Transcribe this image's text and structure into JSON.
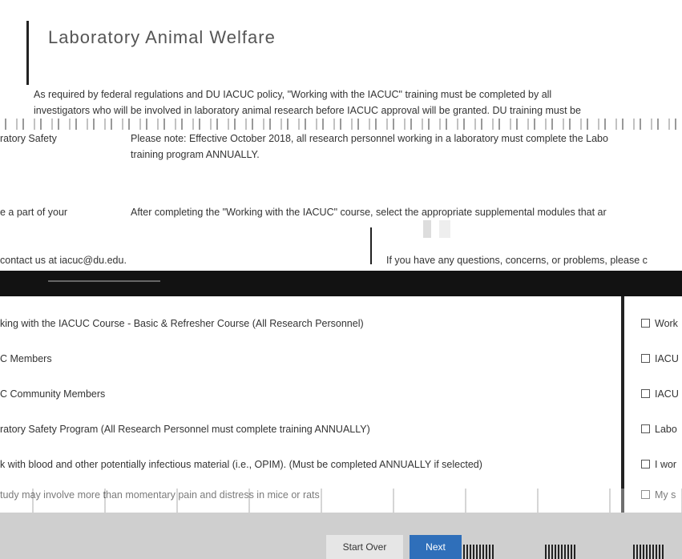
{
  "header": {
    "title": "Laboratory Animal Welfare"
  },
  "intro": {
    "line1": "As required by federal regulations and DU IACUC policy, \"Working with the IACUC\" training must be completed by all",
    "line2": "investigators who will be involved in laboratory animal research before IACUC approval will be granted. DU training must be"
  },
  "left_snippets": {
    "lab_safety": "ratory Safety",
    "part_of_your": "e a part of your",
    "contact": "contact us at iacuc@du.edu."
  },
  "notes": {
    "note1": "Please note: Effective October 2018, all research personnel working in a laboratory must complete the Labo",
    "note1b": "training program ANNUALLY.",
    "note2": "After completing the \"Working with the IACUC\" course, select the appropriate supplemental modules that ar",
    "note3": "If you have any questions, concerns, or problems, please c"
  },
  "modules": [
    {
      "label": "king with the IACUC Course - Basic & Refresher Course (All Research Personnel)",
      "check_label": "Work"
    },
    {
      "label": "C Members",
      "check_label": "IACU"
    },
    {
      "label": "C Community Members",
      "check_label": "IACU"
    },
    {
      "label": "ratory Safety Program (All Research Personnel must complete training ANNUALLY)",
      "check_label": "Labo"
    },
    {
      "label": "k with blood and other potentially infectious material (i.e., OPIM). (Must be completed ANNUALLY if selected)",
      "check_label": "I wor"
    },
    {
      "label": "tudy may involve more than momentary pain and distress in mice or rats",
      "check_label": "My s"
    }
  ],
  "buttons": {
    "start_over": "Start Over",
    "next": "Next"
  }
}
